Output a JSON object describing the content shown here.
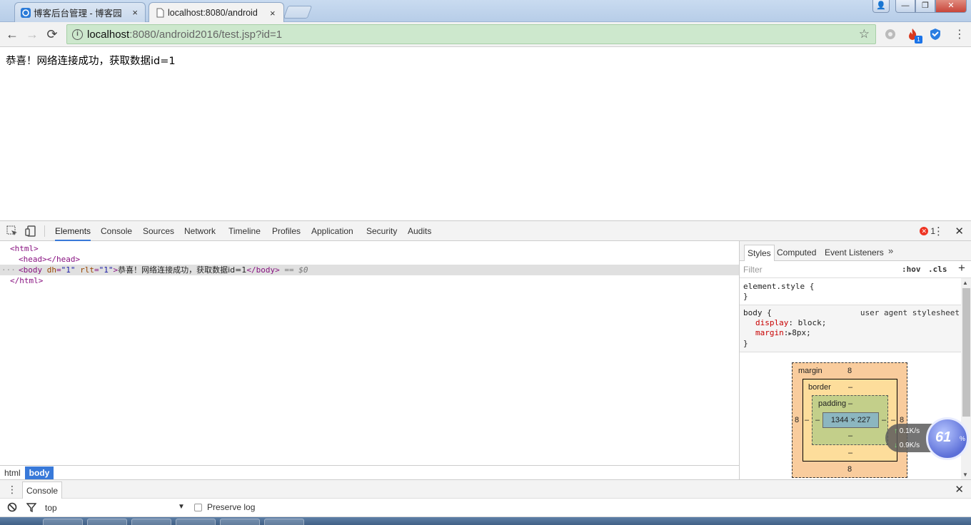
{
  "browser": {
    "tabs": [
      {
        "title": "博客后台管理 - 博客园",
        "close": "×"
      },
      {
        "title": "localhost:8080/android",
        "close": "×"
      }
    ],
    "window_controls": {
      "minimize": "—",
      "maximize": "❐",
      "close": "✕"
    },
    "address": {
      "host": "localhost",
      "rest": ":8080/android2016/test.jsp?id=1"
    },
    "ext_badge": "1"
  },
  "page": {
    "text": "恭喜！网络连接成功，获取数据id=1"
  },
  "devtools": {
    "tabs": [
      "Elements",
      "Console",
      "Sources",
      "Network",
      "Timeline",
      "Profiles",
      "Application",
      "Security",
      "Audits"
    ],
    "active_tab": "Elements",
    "error_count": "1",
    "dom": {
      "html_open": "<html>",
      "head": "<head></head>",
      "body_open": "<body",
      "attr1_name": "dh",
      "attr1_val": "\"1\"",
      "attr2_name": "rlt",
      "attr2_val": "\"1\"",
      "gt": ">",
      "body_text": "恭喜！网络连接成功，获取数据id=1",
      "body_close": "</body>",
      "eq": "== $0",
      "html_close": "</html>",
      "ellipsis": "···"
    },
    "breadcrumbs": [
      "html",
      "body"
    ],
    "drawer": {
      "tab": "Console",
      "context": "top",
      "preserve_log": "Preserve log"
    },
    "styles": {
      "tabs": [
        "Styles",
        "Computed",
        "Event Listeners"
      ],
      "filter_placeholder": "Filter",
      "hov": ":hov",
      "cls": ".cls",
      "element_style": "element.style {",
      "close_brace": "}",
      "body_selector": "body {",
      "ua_source": "user agent stylesheet",
      "props": [
        {
          "name": "display",
          "value": "block;"
        },
        {
          "name": "margin",
          "value": "8px;"
        }
      ]
    },
    "box_model": {
      "margin_label": "margin",
      "margin_top": "8",
      "margin_bottom": "8",
      "margin_left": "8",
      "margin_right": "8",
      "border_label": "border",
      "border_top": "–",
      "border_bottom": "–",
      "border_left": "–",
      "border_right": "–",
      "padding_label": "padding",
      "padding_top": "–",
      "padding_bottom": "–",
      "padding_left": "–",
      "padding_right": "–",
      "content": "1344 × 227"
    }
  },
  "net_widget": {
    "up": "0.1K/s",
    "down": "0.9K/s",
    "percent": "61",
    "pct_sign": "%"
  },
  "colors": {
    "accent": "#3879d9",
    "omnibox": "#cde8cd",
    "selected_row": "#e0e0e0"
  }
}
